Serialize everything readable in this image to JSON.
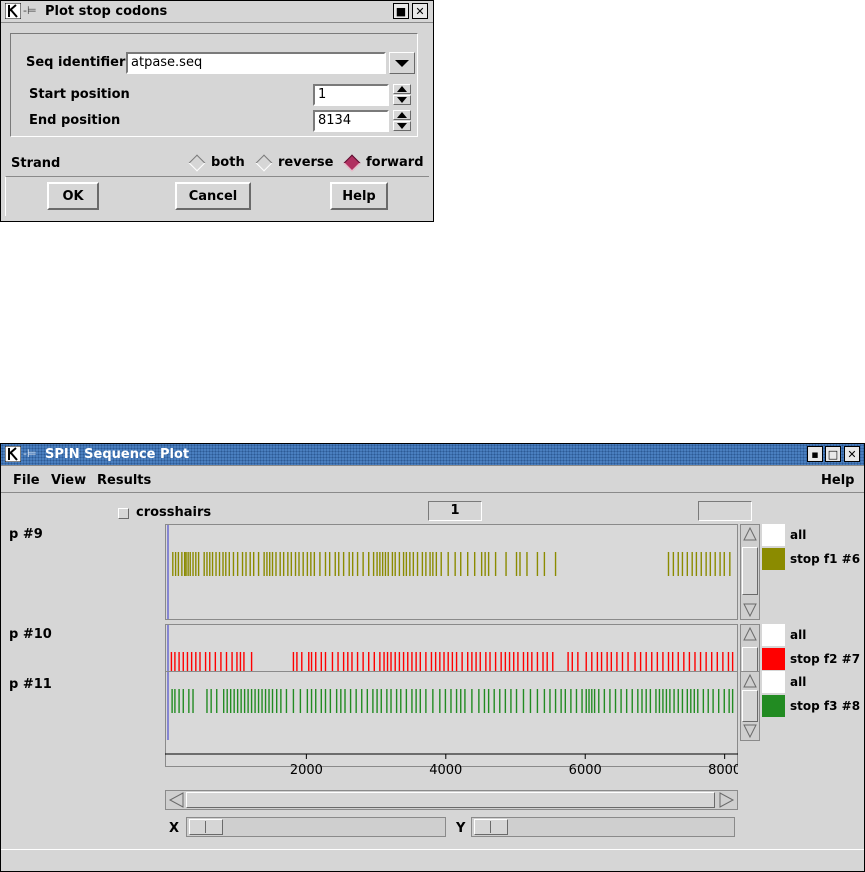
{
  "dialog": {
    "title": "Plot stop codons",
    "seq_identifier_label": "Seq identifier",
    "seq_identifier_value": "atpase.seq",
    "start_position_label": "Start position",
    "start_position_value": "1",
    "end_position_label": "End position",
    "end_position_value": "8134",
    "strand_label": "Strand",
    "strand_options": [
      "both",
      "reverse",
      "forward"
    ],
    "strand_selected": "forward",
    "ok_label": "OK",
    "cancel_label": "Cancel",
    "help_label": "Help"
  },
  "plot_window": {
    "title": "SPIN Sequence Plot",
    "menu": {
      "file": "File",
      "view": "View",
      "results": "Results",
      "help": "Help"
    },
    "crosshairs_label": "crosshairs",
    "position_value": "1",
    "plots": [
      {
        "label": "p #9",
        "legend_all": "all",
        "legend_series": "stop f1 #6",
        "color": "#8b8b00",
        "stops": [
          70,
          110,
          150,
          200,
          240,
          260,
          290,
          320,
          360,
          400,
          440,
          520,
          560,
          600,
          640,
          690,
          740,
          790,
          830,
          880,
          940,
          1000,
          1070,
          1120,
          1180,
          1230,
          1300,
          1380,
          1420,
          1460,
          1500,
          1550,
          1610,
          1660,
          1720,
          1770,
          1830,
          1880,
          1940,
          2000,
          2050,
          2100,
          2180,
          2260,
          2320,
          2400,
          2450,
          2520,
          2600,
          2650,
          2720,
          2800,
          2880,
          2950,
          3000,
          3040,
          3080,
          3120,
          3160,
          3220,
          3260,
          3320,
          3380,
          3420,
          3470,
          3520,
          3580,
          3650,
          3700,
          3760,
          3800,
          3850,
          3920,
          4020,
          4120,
          4200,
          4300,
          4400,
          4500,
          4550,
          4600,
          4700,
          4850,
          5000,
          5050,
          5150,
          5300,
          5400,
          5560,
          7180,
          7250,
          7320,
          7380,
          7450,
          7520,
          7580,
          7650,
          7720,
          7780,
          7850,
          7920,
          7980,
          8060
        ]
      },
      {
        "label": "p #10",
        "legend_all": "all",
        "legend_series": "stop f2 #7",
        "color": "#ff0000",
        "stops": [
          50,
          100,
          160,
          220,
          280,
          340,
          400,
          460,
          540,
          600,
          680,
          760,
          840,
          920,
          990,
          1040,
          1090,
          1200,
          1800,
          1850,
          1920,
          2020,
          2060,
          2120,
          2200,
          2260,
          2360,
          2440,
          2520,
          2580,
          2640,
          2720,
          2800,
          2880,
          2960,
          3040,
          3100,
          3150,
          3200,
          3260,
          3320,
          3380,
          3440,
          3500,
          3560,
          3620,
          3700,
          3780,
          3840,
          3900,
          3960,
          4020,
          4080,
          4140,
          4220,
          4300,
          4360,
          4420,
          4480,
          4560,
          4620,
          4700,
          4780,
          4840,
          4900,
          4960,
          5020,
          5100,
          5160,
          5220,
          5300,
          5380,
          5440,
          5520,
          5740,
          5800,
          5880,
          6000,
          6080,
          6160,
          6220,
          6300,
          6360,
          6440,
          6520,
          6600,
          6700,
          6780,
          6860,
          6940,
          7020,
          7100,
          7180,
          7240,
          7320,
          7400,
          7480,
          7560,
          7640,
          7720,
          7800,
          7880,
          7960,
          8040,
          8100
        ]
      },
      {
        "label": "p #11",
        "legend_all": "all",
        "legend_series": "stop f3 #8",
        "color": "#228b22",
        "stops": [
          60,
          100,
          160,
          220,
          300,
          360,
          560,
          620,
          700,
          800,
          850,
          900,
          950,
          1000,
          1050,
          1100,
          1150,
          1200,
          1250,
          1300,
          1350,
          1400,
          1450,
          1500,
          1560,
          1620,
          1700,
          1800,
          1900,
          2000,
          2060,
          2120,
          2200,
          2260,
          2330,
          2420,
          2480,
          2540,
          2620,
          2700,
          2780,
          2860,
          2940,
          3000,
          3060,
          3140,
          3200,
          3280,
          3340,
          3420,
          3500,
          3560,
          3620,
          3700,
          3800,
          3900,
          3980,
          4060,
          4140,
          4200,
          4260,
          4360,
          4460,
          4540,
          4600,
          4680,
          4760,
          4840,
          4920,
          5000,
          5100,
          5200,
          5300,
          5400,
          5480,
          5560,
          5640,
          5700,
          5780,
          5860,
          5940,
          6000,
          6040,
          6080,
          6120,
          6180,
          6260,
          6340,
          6420,
          6500,
          6580,
          6660,
          6740,
          6800,
          6860,
          6920,
          7000,
          7050,
          7100,
          7150,
          7200,
          7260,
          7320,
          7380,
          7450,
          7500,
          7550,
          7600,
          7680,
          7750,
          7820,
          7900,
          7980,
          8050,
          8100
        ]
      }
    ],
    "x_axis": {
      "min": 1,
      "max": 8134,
      "ticks": [
        2000,
        4000,
        6000,
        8000
      ],
      "tick_labels": [
        "2000",
        "4000",
        "6000",
        "8000"
      ]
    },
    "x_label": "X",
    "y_label": "Y"
  }
}
